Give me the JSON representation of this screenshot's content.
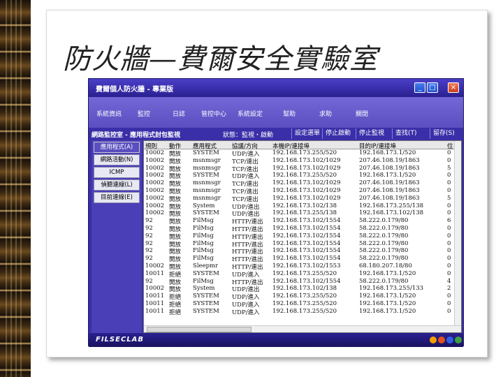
{
  "slide": {
    "title": "防火牆—費爾安全實驗室"
  },
  "window": {
    "title": "費爾個人防火牆 - 專業版",
    "buttons": {
      "minimize": "_",
      "maximize": "□",
      "close": "×"
    }
  },
  "menu": {
    "items": [
      "系統資訊",
      "監控",
      "日誌",
      "管控中心",
      "系統設定",
      "幫助",
      "求助",
      "關閉"
    ]
  },
  "subbar": {
    "breadcrumb": "網路監控室 - 應用程式封包監視",
    "status": "狀態：監視・啟動",
    "buttons": [
      "設定選單",
      "停止啟動",
      "停止監視",
      "查找(T)",
      "留存(S)"
    ]
  },
  "sidebar": {
    "items": [
      "應用程式(A)",
      "網路活動(N)",
      "ICMP",
      "偵聽連線(L)",
      "目前連線(E)"
    ],
    "active_index": 0
  },
  "table": {
    "headers": [
      "規則",
      "動作",
      "應用程式",
      "協議/方向",
      "本機IP/連接埠",
      "目的IP/連接埠",
      "位"
    ],
    "rows": [
      [
        "10002",
        "開放",
        "SYSTEM",
        "UDP/進入",
        "192.168.173.255/520",
        "192.168.173.1/520",
        "0"
      ],
      [
        "10002",
        "開放",
        "msnmsgr",
        "TCP/連出",
        "192.168.173.102/1029",
        "207.46.108.19/1863",
        "0"
      ],
      [
        "10002",
        "開放",
        "msnmsgr",
        "TCP/進出",
        "192.168.173.102/1029",
        "207.46.108.19/1863",
        "5"
      ],
      [
        "10002",
        "開放",
        "SYSTEM",
        "UDP/進入",
        "192.168.173.255/520",
        "192.168.173.1/520",
        "0"
      ],
      [
        "10002",
        "開放",
        "msnmsgr",
        "TCP/連出",
        "192.168.173.102/1029",
        "207.46.108.19/1863",
        "0"
      ],
      [
        "10002",
        "開放",
        "msnmsgr",
        "TCP/進出",
        "192.168.173.102/1029",
        "207.46.108.19/1863",
        "0"
      ],
      [
        "10002",
        "開放",
        "msnmsgr",
        "TCP/連出",
        "192.168.173.102/1029",
        "207.46.108.19/1863",
        "5"
      ],
      [
        "10002",
        "開放",
        "System",
        "UDP/進出",
        "192.168.173.102/138",
        "192.168.173.255/138",
        "0"
      ],
      [
        "10002",
        "開放",
        "SYSTEM",
        "UDP/進出",
        "192.168.173.255/138",
        "192.168.173.102/138",
        "0"
      ],
      [
        "92",
        "開放",
        "FilMsg",
        "HTTP/連出",
        "192.168.173.102/1554",
        "58.222.0.179/80",
        "6"
      ],
      [
        "92",
        "開放",
        "FilMsg",
        "HTTP/進出",
        "192.168.173.102/1554",
        "58.222.0.179/80",
        "0"
      ],
      [
        "92",
        "開放",
        "FilMsg",
        "HTTP/連出",
        "192.168.173.102/1554",
        "58.222.0.179/80",
        "0"
      ],
      [
        "92",
        "開放",
        "FilMsg",
        "HTTP/進出",
        "192.168.173.102/1554",
        "58.222.0.179/80",
        "0"
      ],
      [
        "92",
        "開放",
        "FilMsg",
        "HTTP/連出",
        "192.168.173.102/1554",
        "58.222.0.179/80",
        "0"
      ],
      [
        "92",
        "開放",
        "FilMsg",
        "HTTP/進出",
        "192.168.173.102/1554",
        "58.222.0.179/80",
        "0"
      ],
      [
        "10002",
        "開放",
        "Sleepmr",
        "HTTP/連出",
        "192.168.173.102/1553",
        "68.180.207.18/80",
        "0"
      ],
      [
        "10011",
        "拒絕",
        "SYSTEM",
        "UDP/進入",
        "192.168.173.255/520",
        "192.168.173.1/520",
        "0"
      ],
      [
        "92",
        "開放",
        "FilMsg",
        "HTTP/進出",
        "192.168.173.102/1554",
        "58.222.0.179/80",
        "4"
      ],
      [
        "10002",
        "開放",
        "System",
        "UDP/進出",
        "192.168.173.102/138",
        "192.168.173.255/133",
        "2"
      ],
      [
        "10011",
        "拒絕",
        "SYSTEM",
        "UDP/進入",
        "192.168.173.255/520",
        "192.168.173.1/520",
        "0"
      ],
      [
        "10011",
        "拒絕",
        "SYSTEM",
        "UDP/進入",
        "192.168.173.255/520",
        "192.168.173.1/520",
        "0"
      ],
      [
        "10011",
        "拒絕",
        "SYSTEM",
        "UDP/進入",
        "192.168.173.255/520",
        "192.168.173.1/520",
        "0"
      ]
    ]
  },
  "footer": {
    "brand": "FILSECLAB",
    "dot_colors": [
      "#f0a000",
      "#e05020",
      "#3060e0",
      "#40a040"
    ]
  },
  "colors": {
    "window_bg": "#3a2fa8",
    "menu_bg": "#6a5ed0",
    "accent": "#2a2090"
  }
}
